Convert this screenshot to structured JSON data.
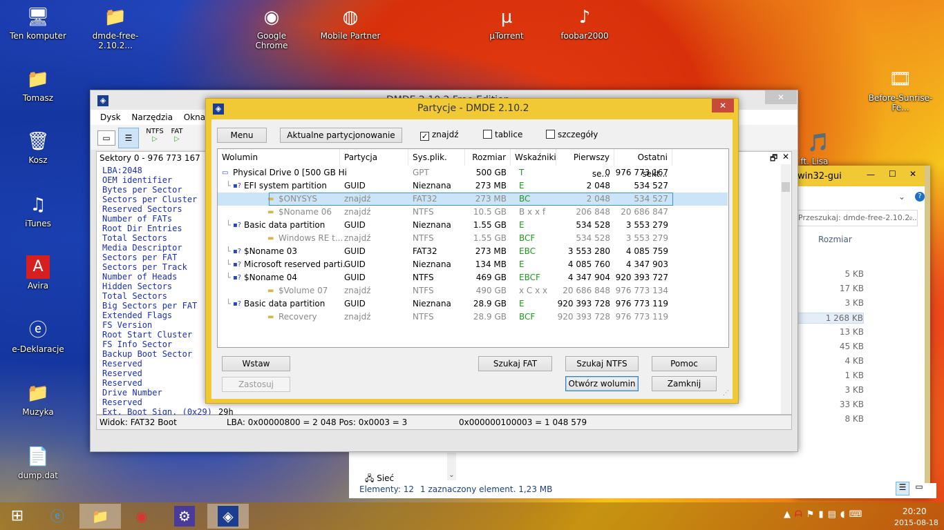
{
  "desktop_icons": [
    {
      "label": "Ten komputer",
      "icon": "computer-icon"
    },
    {
      "label": "dmde-free-2.10.2...",
      "icon": "folder-icon"
    },
    {
      "label": "Google Chrome",
      "icon": "chrome-icon"
    },
    {
      "label": "Mobile Partner",
      "icon": "mobile-partner-icon"
    },
    {
      "label": "µTorrent",
      "icon": "utorrent-icon"
    },
    {
      "label": "foobar2000",
      "icon": "foobar-icon"
    },
    {
      "label": "Tomasz",
      "icon": "user-folder-icon"
    },
    {
      "label": "Before-Sunrise-Fe...",
      "icon": "video-icon"
    },
    {
      "label": "Kosz",
      "icon": "recycle-bin-icon"
    },
    {
      "label": "iTunes",
      "icon": "itunes-icon"
    },
    {
      "label": "Avira",
      "icon": "avira-icon"
    },
    {
      "label": "e-Deklaracje",
      "icon": "edeklaracje-icon"
    },
    {
      "label": "Muzyka",
      "icon": "music-folder-icon"
    },
    {
      "label": "dump.dat",
      "icon": "file-icon"
    },
    {
      "label": "c ft. Lisa Lopes...",
      "icon": "mp3-icon"
    }
  ],
  "dmde": {
    "title": "DMDE 2.10.2 Free Edition",
    "menu": [
      "Dysk",
      "Narzędzia",
      "Okna",
      "P"
    ],
    "toolbar": {
      "ntfs": "NTFS",
      "fat": "FAT"
    },
    "sectors_label": "Sektory 0 - 976 773 167",
    "fields": [
      "LBA:2048",
      "OEM identifier",
      "Bytes per Sector",
      "Sectors per Cluster",
      "Reserved Sectors",
      "Number of FATs",
      "Root Dir Entries",
      "Total Sectors",
      "Media Descriptor",
      "Sectors per FAT",
      "Sectors per Track",
      "Number of Heads",
      "Hidden Sectors",
      "Total Sectors",
      "Big Sectors per FAT",
      "Extended Flags",
      "FS Version",
      "Root Start Cluster",
      "FS Info Sector",
      "Backup Boot Sector",
      "Reserved",
      "Reserved",
      "Reserved",
      "Drive Number",
      "Reserved",
      "Ext. Boot Sign. (0x29)"
    ],
    "last_value": "29h",
    "status": {
      "view": "Widok: FAT32 Boot",
      "lba": "LBA: 0x00000800 = 2 048  Pos: 0x0003 = 3",
      "offset": "0x000000100003 = 1 048 579"
    }
  },
  "dialog": {
    "title": "Partycje - DMDE 2.10.2",
    "buttons_top": {
      "menu": "Menu",
      "current": "Aktualne partycjonowanie"
    },
    "checks": [
      {
        "label": "znajdź",
        "checked": true
      },
      {
        "label": "tablice",
        "checked": false
      },
      {
        "label": "szczegóły",
        "checked": false
      }
    ],
    "headers": [
      "Wolumin",
      "Partycja",
      "Sys.plik.",
      "Rozmiar",
      "Wskaźniki",
      "Pierwszy se...",
      "Ostatni sekt..."
    ],
    "rows": [
      {
        "name": "Physical Drive 0 [500 GB Hi...",
        "part": "",
        "fs": "GPT",
        "size": "500 GB",
        "flags": "T",
        "first": "0",
        "last": "976 773 167",
        "lvl": 0,
        "gray": false,
        "fsgray": true
      },
      {
        "name": "EFI system partition",
        "part": "GUID",
        "fs": "Nieznana",
        "size": "273 MB",
        "flags": "E",
        "first": "2 048",
        "last": "534 527",
        "lvl": 1,
        "gray": false
      },
      {
        "name": "$ONYSYS",
        "part": "znajdź",
        "fs": "FAT32",
        "size": "273 MB",
        "flags": "BC",
        "first": "2 048",
        "last": "534 527",
        "lvl": 2,
        "gray": true,
        "sel": true
      },
      {
        "name": "$Noname 06",
        "part": "znajdź",
        "fs": "NTFS",
        "size": "10.5 GB",
        "flags": "B x x f",
        "first": "206 848",
        "last": "20 686 847",
        "lvl": 2,
        "gray": true
      },
      {
        "name": "Basic data partition",
        "part": "GUID",
        "fs": "Nieznana",
        "size": "1.55 GB",
        "flags": "E",
        "first": "534 528",
        "last": "3 553 279",
        "lvl": 1,
        "gray": false
      },
      {
        "name": "Windows RE t...",
        "part": "znajdź",
        "fs": "NTFS",
        "size": "1.55 GB",
        "flags": "BCF",
        "first": "534 528",
        "last": "3 553 279",
        "lvl": 2,
        "gray": true
      },
      {
        "name": "$Noname 03",
        "part": "GUID",
        "fs": "FAT32",
        "size": "273 MB",
        "flags": "EBC",
        "first": "3 553 280",
        "last": "4 085 759",
        "lvl": 1,
        "gray": false
      },
      {
        "name": "Microsoft reserved parti...",
        "part": "GUID",
        "fs": "Nieznana",
        "size": "134 MB",
        "flags": "E",
        "first": "4 085 760",
        "last": "4 347 903",
        "lvl": 1,
        "gray": false
      },
      {
        "name": "$Noname 04",
        "part": "GUID",
        "fs": "NTFS",
        "size": "469 GB",
        "flags": "EBCF",
        "first": "4 347 904",
        "last": "920 393 727",
        "lvl": 1,
        "gray": false
      },
      {
        "name": "$Volume 07",
        "part": "znajdź",
        "fs": "NTFS",
        "size": "490 GB",
        "flags": "x C x x",
        "first": "20 686 848",
        "last": "976 773 134",
        "lvl": 2,
        "gray": true
      },
      {
        "name": "Basic data partition",
        "part": "GUID",
        "fs": "Nieznana",
        "size": "28.9 GB",
        "flags": "E",
        "first": "920 393 728",
        "last": "976 773 119",
        "lvl": 1,
        "gray": false
      },
      {
        "name": "Recovery",
        "part": "znajdź",
        "fs": "NTFS",
        "size": "28.9 GB",
        "flags": "BCF",
        "first": "920 393 728",
        "last": "976 773 119",
        "lvl": 2,
        "gray": true
      }
    ],
    "buttons": {
      "insert": "Wstaw",
      "apply": "Zastosuj",
      "search_fat": "Szukaj FAT",
      "search_ntfs": "Szukaj NTFS",
      "help": "Pomoc",
      "open": "Otwórz wolumin",
      "close": "Zamknij"
    }
  },
  "explorer": {
    "title": "win32-gui",
    "search": "Przeszukaj: dmde-free-2.10.2...",
    "size_header": "Rozmiar",
    "sizes": [
      "5 KB",
      "17 KB",
      "3 KB",
      "1 268 KB",
      "13 KB",
      "45 KB",
      "4 KB",
      "1 KB",
      "3 KB",
      "33 KB",
      "8 KB"
    ],
    "nav_item": "Sieć",
    "status_count": "Elementy: 12",
    "status_sel": "1 zaznaczony element. 1,23 MB"
  },
  "taskbar": {
    "time": "20:20",
    "date": "2015-08-18"
  }
}
